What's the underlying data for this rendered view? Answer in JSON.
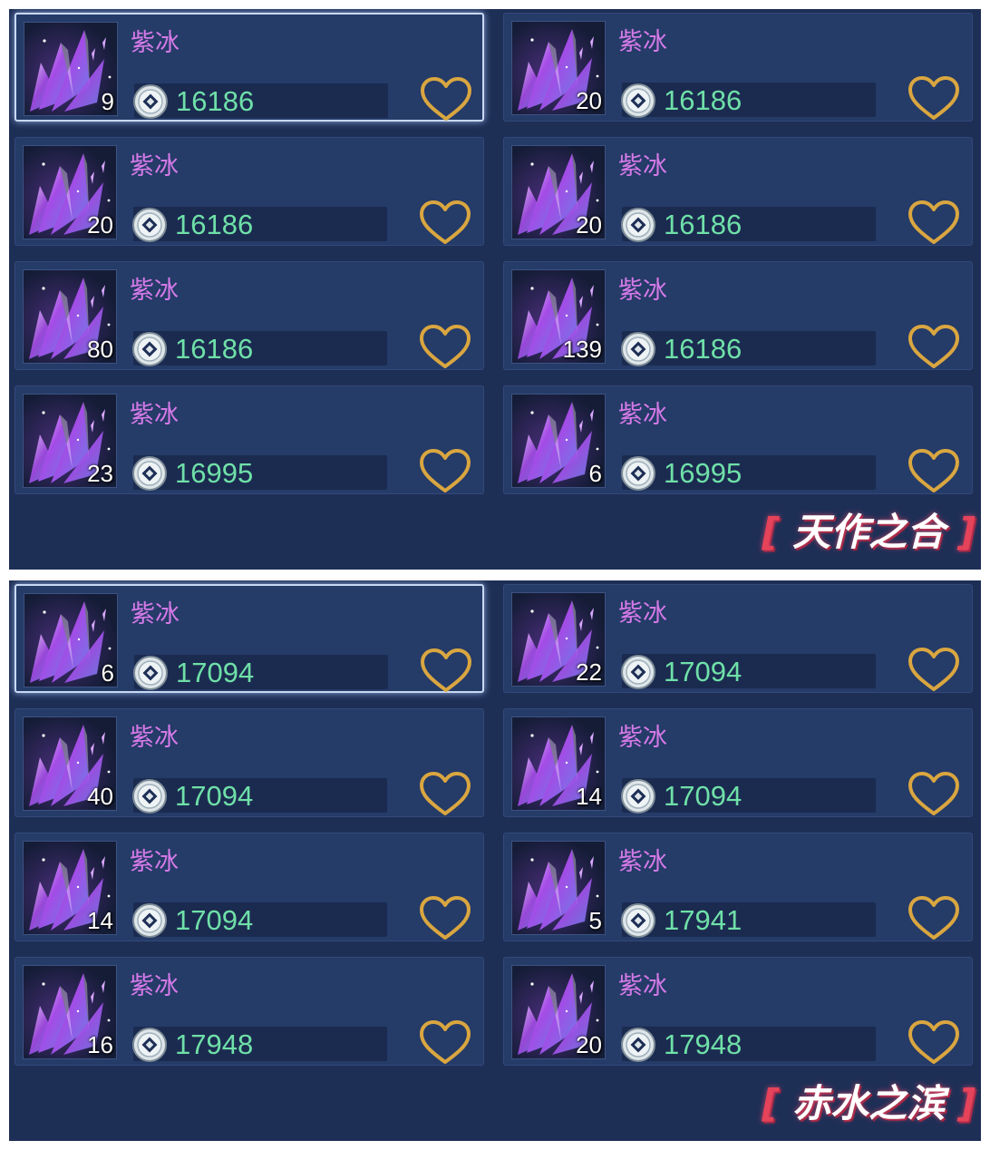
{
  "panels": [
    {
      "tag": "天作之合",
      "items": [
        {
          "name": "紫冰",
          "qty": "9",
          "price": "16186",
          "selected": true
        },
        {
          "name": "紫冰",
          "qty": "20",
          "price": "16186",
          "selected": false
        },
        {
          "name": "紫冰",
          "qty": "20",
          "price": "16186",
          "selected": false
        },
        {
          "name": "紫冰",
          "qty": "20",
          "price": "16186",
          "selected": false
        },
        {
          "name": "紫冰",
          "qty": "80",
          "price": "16186",
          "selected": false
        },
        {
          "name": "紫冰",
          "qty": "139",
          "price": "16186",
          "selected": false
        },
        {
          "name": "紫冰",
          "qty": "23",
          "price": "16995",
          "selected": false
        },
        {
          "name": "紫冰",
          "qty": "6",
          "price": "16995",
          "selected": false
        }
      ]
    },
    {
      "tag": "赤水之滨",
      "items": [
        {
          "name": "紫冰",
          "qty": "6",
          "price": "17094",
          "selected": true
        },
        {
          "name": "紫冰",
          "qty": "22",
          "price": "17094",
          "selected": false
        },
        {
          "name": "紫冰",
          "qty": "40",
          "price": "17094",
          "selected": false
        },
        {
          "name": "紫冰",
          "qty": "14",
          "price": "17094",
          "selected": false
        },
        {
          "name": "紫冰",
          "qty": "14",
          "price": "17094",
          "selected": false
        },
        {
          "name": "紫冰",
          "qty": "5",
          "price": "17941",
          "selected": false
        },
        {
          "name": "紫冰",
          "qty": "16",
          "price": "17948",
          "selected": false
        },
        {
          "name": "紫冰",
          "qty": "20",
          "price": "17948",
          "selected": false
        }
      ]
    }
  ],
  "icons": {
    "item": "purple-crystal-icon",
    "currency": "silver-coin-icon",
    "favorite": "heart-outline-icon"
  },
  "colors": {
    "panel_bg": "#1e2f56",
    "card_bg": "#253b68",
    "name": "#d57ae8",
    "price": "#6fe0a8",
    "heart": "#d9a640",
    "tag_accent": "#e5435a"
  }
}
